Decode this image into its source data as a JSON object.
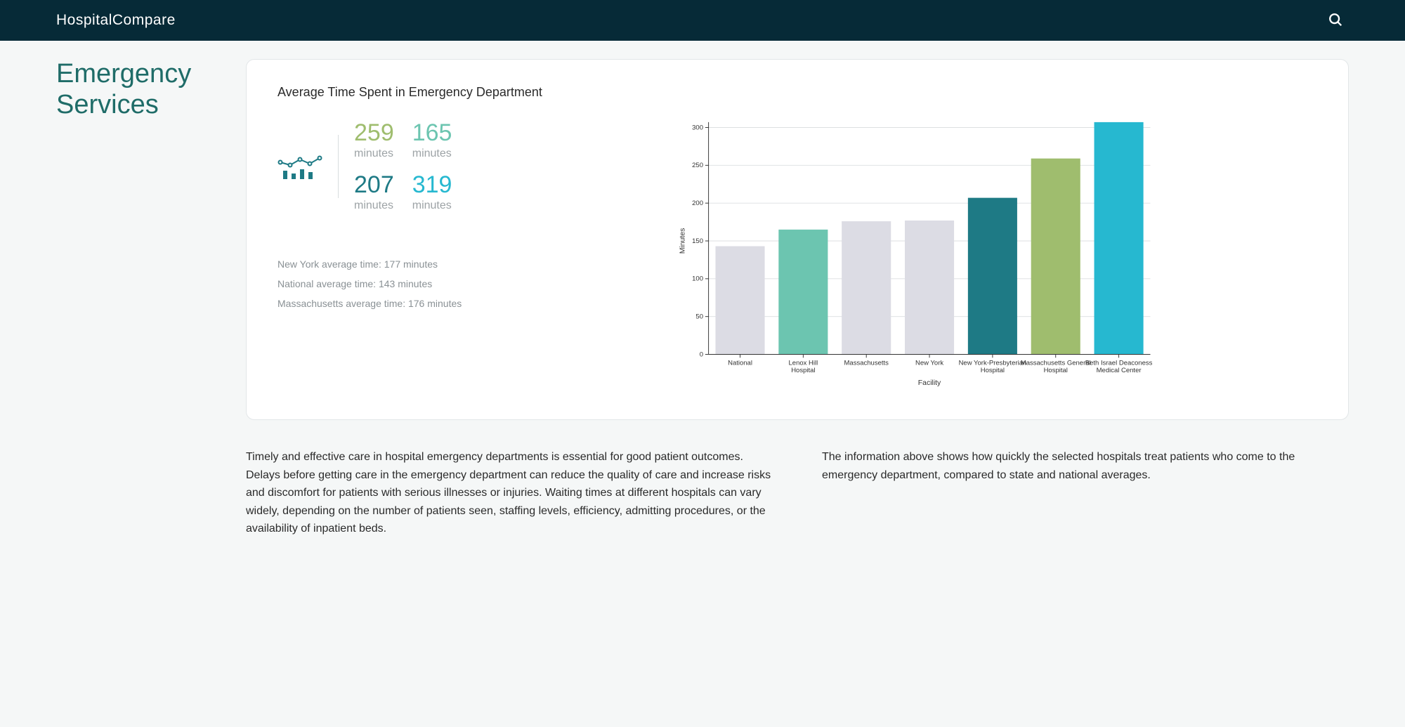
{
  "brand": {
    "light": "Hospital",
    "bold": "Compare"
  },
  "page_title": "Emergency Services",
  "card": {
    "title": "Average Time Spent in Emergency Department",
    "stats": [
      {
        "value": "259",
        "unit": "minutes",
        "color_class": "c-olive"
      },
      {
        "value": "165",
        "unit": "minutes",
        "color_class": "c-mint"
      },
      {
        "value": "207",
        "unit": "minutes",
        "color_class": "c-teal"
      },
      {
        "value": "319",
        "unit": "minutes",
        "color_class": "c-cyan"
      }
    ],
    "averages": [
      "New York average time: 177 minutes",
      "National average time: 143 minutes",
      "Massachusetts average time: 176 minutes"
    ]
  },
  "chart_data": {
    "type": "bar",
    "title": "Average Time Spent in Emergency Department",
    "xlabel": "Facility",
    "ylabel": "Minutes",
    "ylim": [
      0,
      300
    ],
    "yticks": [
      0,
      50,
      100,
      150,
      200,
      250,
      300
    ],
    "categories": [
      "National",
      "Lenox Hill Hospital",
      "Massachusetts",
      "New York",
      "New York-Presbyterian Hospital",
      "Massachusetts General Hospital",
      "Beth Israel Deaconess Medical Center"
    ],
    "values": [
      143,
      165,
      176,
      177,
      207,
      259,
      319
    ],
    "colors": [
      "#dcdce4",
      "#6cc5b0",
      "#dcdce4",
      "#dcdce4",
      "#1e7a85",
      "#9fbd6e",
      "#26b8d0"
    ]
  },
  "description": {
    "left": "Timely and effective care in hospital emergency departments is essential for good patient outcomes. Delays before getting care in the emergency department can reduce the quality of care and increase risks and discomfort for patients with serious illnesses or injuries. Waiting times at different hospitals can vary widely, depending on the number of patients seen, staffing levels, efficiency, admitting procedures, or the availability of inpatient beds.",
    "right": "The information above shows how quickly the selected hospitals treat patients who come to the emergency department, compared to state and national averages."
  }
}
